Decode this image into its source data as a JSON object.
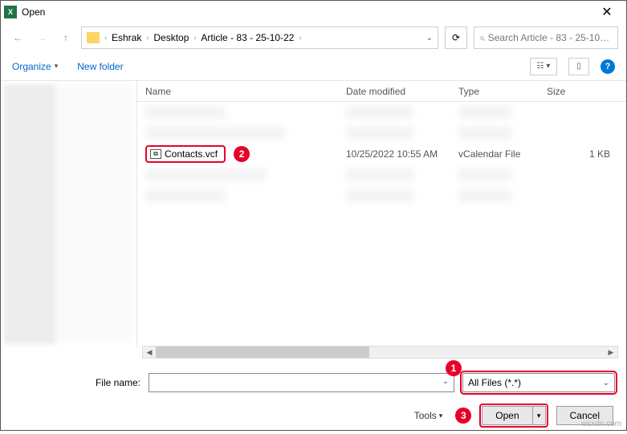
{
  "window": {
    "title": "Open"
  },
  "breadcrumb": {
    "p1": "Eshrak",
    "p2": "Desktop",
    "p3": "Article - 83 - 25-10-22"
  },
  "search": {
    "placeholder": "Search Article - 83 - 25-10-22"
  },
  "toolbar": {
    "organize": "Organize",
    "newfolder": "New folder"
  },
  "columns": {
    "name": "Name",
    "date": "Date modified",
    "type": "Type",
    "size": "Size"
  },
  "file": {
    "name": "Contacts.vcf",
    "date": "10/25/2022 10:55 AM",
    "type": "vCalendar File",
    "size": "1 KB"
  },
  "footer": {
    "filename_label": "File name:",
    "filter": "All Files (*.*)",
    "tools": "Tools",
    "open": "Open",
    "cancel": "Cancel"
  },
  "badges": {
    "b1": "1",
    "b2": "2",
    "b3": "3"
  },
  "watermark": "wsxdn.com"
}
